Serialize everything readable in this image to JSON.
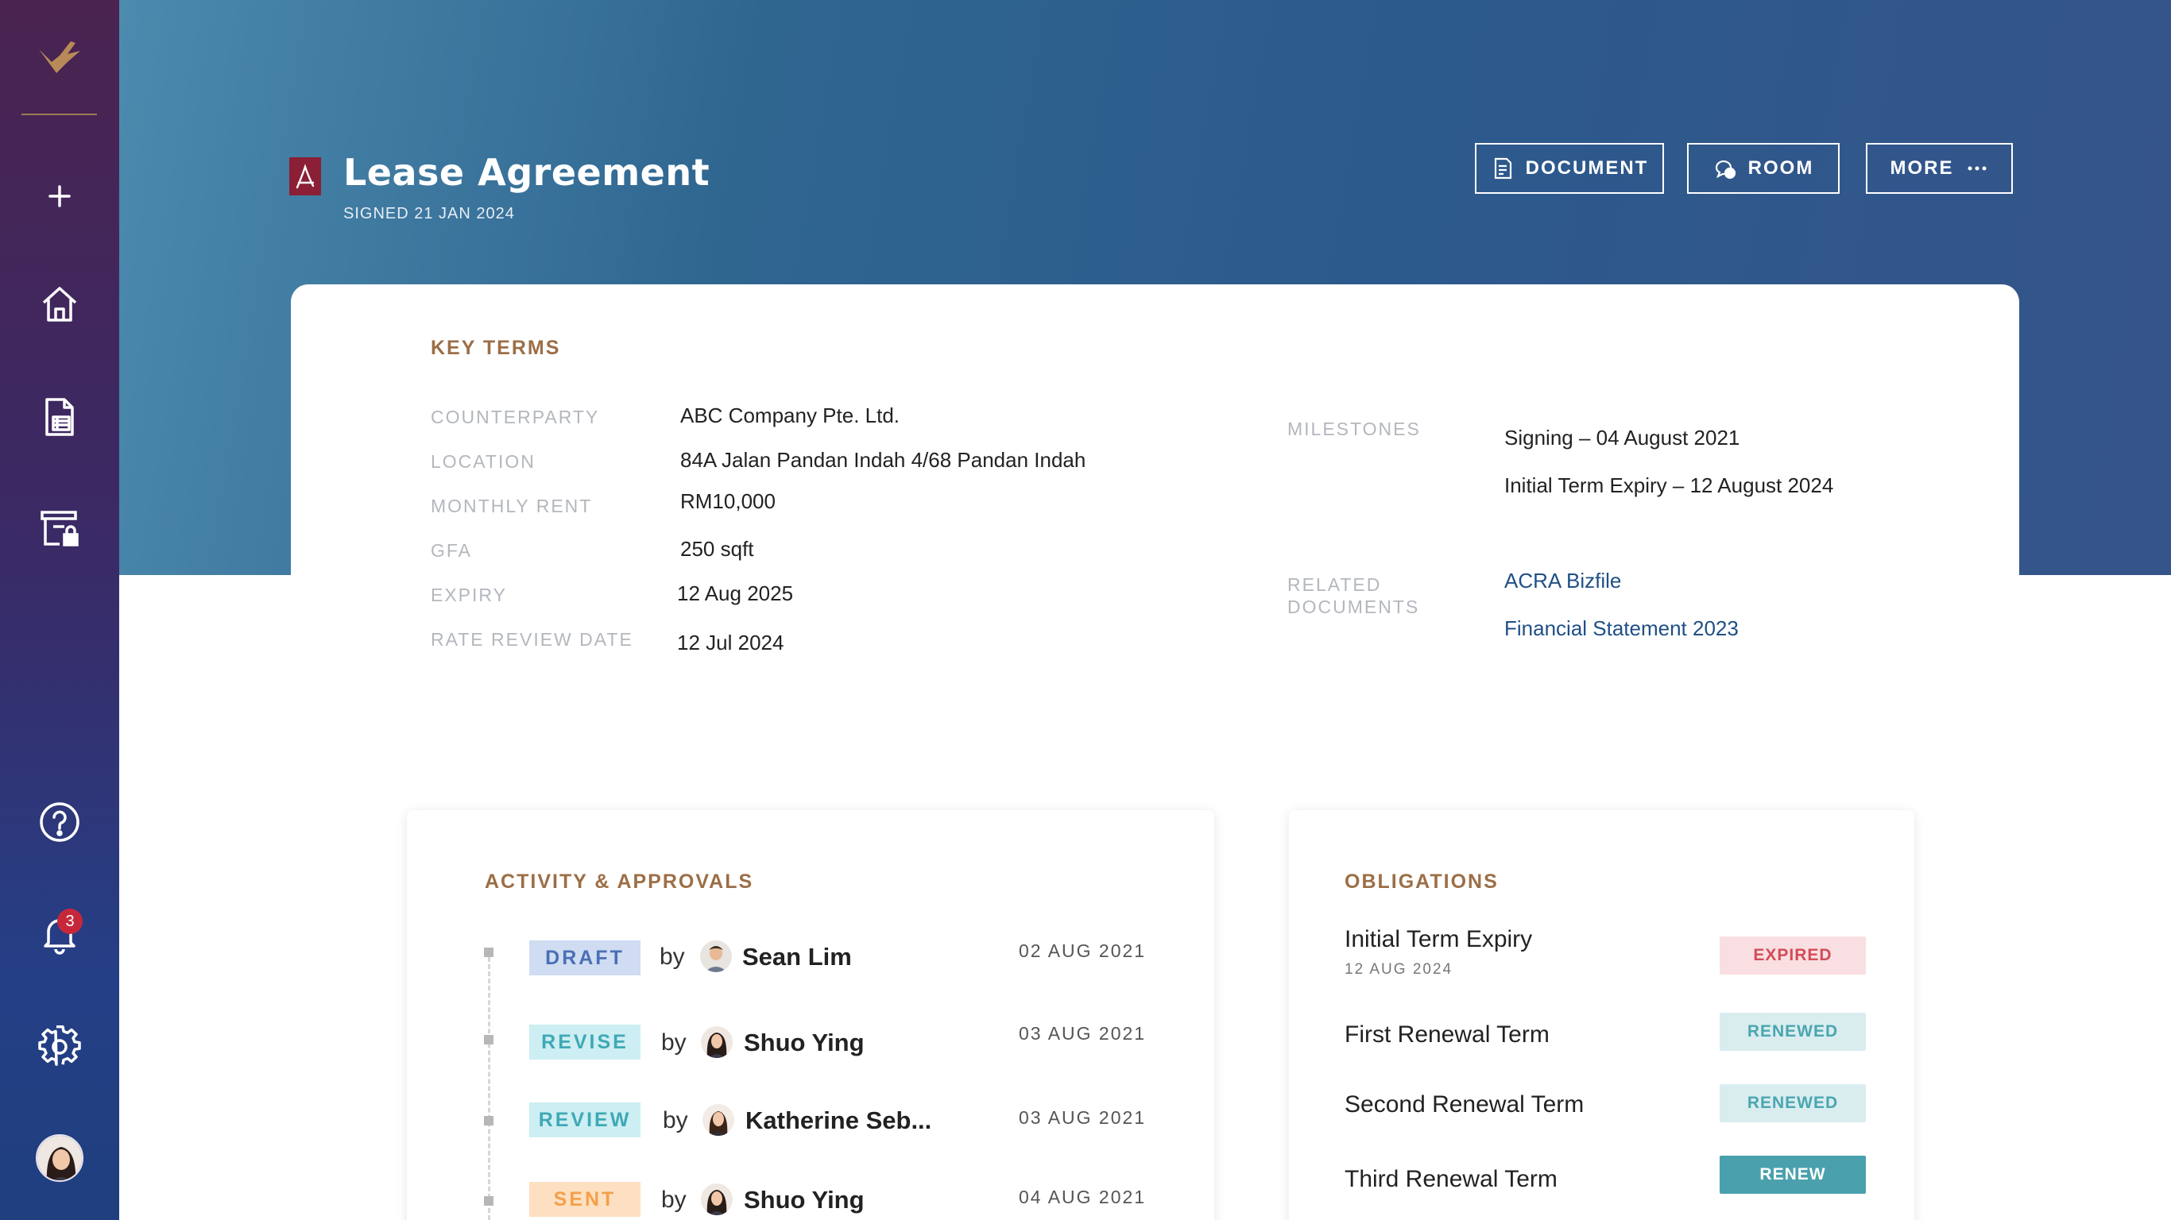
{
  "colors": {
    "accent_brown": "#9c6e46",
    "link_blue": "#1f4f86",
    "badge_red": "#c6283a",
    "draft_bg": "#cfdcf2",
    "draft_fg": "#4a6fb5",
    "revise_bg": "#cdeef2",
    "revise_fg": "#3ea9b6",
    "sent_bg": "#fde0c2",
    "sent_fg": "#f4a04a",
    "expired_bg": "#f9dfe1",
    "expired_fg": "#d24b58",
    "renewed_bg": "#d9edef",
    "renewed_fg": "#4aa6b0",
    "renew_bg": "#4aa1ad",
    "renew_fg": "#ffffff"
  },
  "sidebar": {
    "logo_icon": "bird-logo-icon",
    "icons": [
      "plus-icon",
      "home-icon",
      "document-list-icon",
      "locked-archive-icon",
      "help-icon",
      "bell-icon",
      "gear-icon",
      "avatar"
    ],
    "notification_count": "3"
  },
  "header": {
    "file_icon": "pdf-icon",
    "title": "Lease Agreement",
    "subtitle": "SIGNED 21 JAN 2024",
    "buttons": {
      "document": "DOCUMENT",
      "room": "ROOM",
      "more": "MORE"
    }
  },
  "key_terms": {
    "title": "KEY TERMS",
    "rows": [
      {
        "label": "COUNTERPARTY",
        "value": "ABC Company Pte. Ltd."
      },
      {
        "label": "LOCATION",
        "value": "84A Jalan Pandan Indah 4/68 Pandan Indah"
      },
      {
        "label": "MONTHLY RENT",
        "value": "RM10,000"
      },
      {
        "label": "GFA",
        "value": "250 sqft"
      },
      {
        "label": "EXPIRY",
        "value": "12 Aug 2025"
      },
      {
        "label": "RATE REVIEW DATE",
        "value": "12 Jul 2024"
      }
    ],
    "milestones_label": "MILESTONES",
    "milestones": [
      "Signing – 04 August 2021",
      "Initial Term Expiry – 12 August 2024"
    ],
    "related_label_1": "RELATED",
    "related_label_2": "DOCUMENTS",
    "related_docs": [
      "ACRA Bizfile",
      "Financial Statement 2023"
    ]
  },
  "activity": {
    "title": "ACTIVITY & APPROVALS",
    "by": "by",
    "items": [
      {
        "status": "DRAFT",
        "name": "Sean Lim",
        "date": "02 AUG 2021"
      },
      {
        "status": "REVISE",
        "name": "Shuo Ying",
        "date": "03 AUG 2021"
      },
      {
        "status": "REVIEW",
        "name": "Katherine Seb...",
        "date": "03 AUG 2021"
      },
      {
        "status": "SENT",
        "name": "Shuo Ying",
        "date": "04 AUG 2021"
      }
    ]
  },
  "obligations": {
    "title": "OBLIGATIONS",
    "items": [
      {
        "name": "Initial Term Expiry",
        "sub": "12 AUG 2024",
        "status": "EXPIRED"
      },
      {
        "name": "First Renewal Term",
        "status": "RENEWED"
      },
      {
        "name": "Second Renewal Term",
        "status": "RENEWED"
      },
      {
        "name": "Third Renewal Term",
        "status": "RENEW"
      }
    ]
  }
}
